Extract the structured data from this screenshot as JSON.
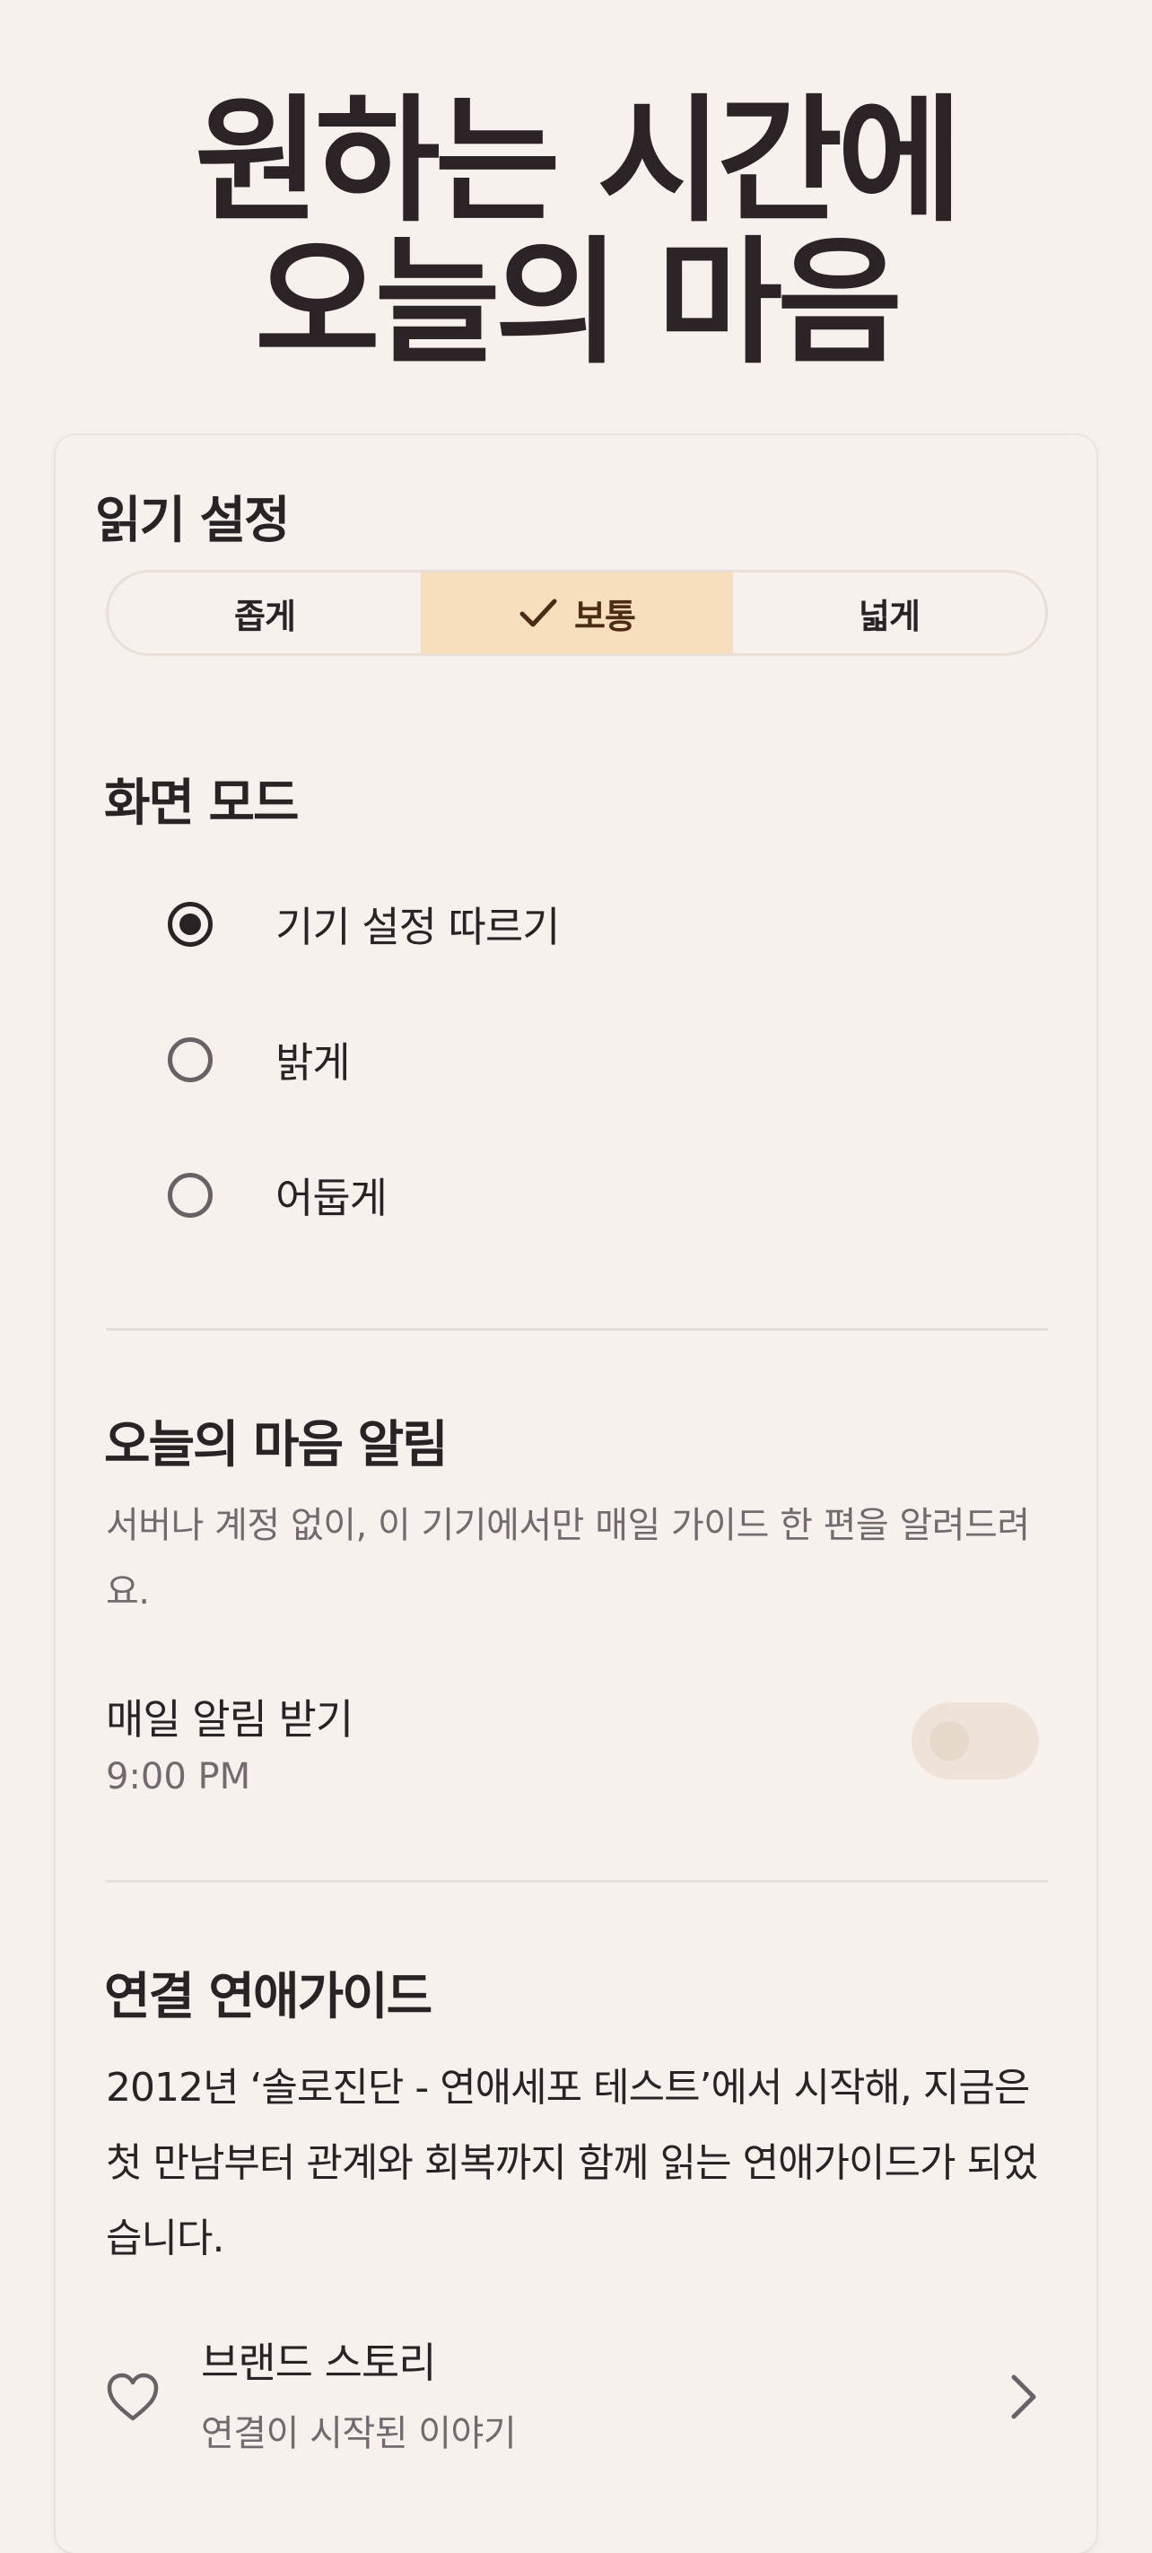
{
  "hero": {
    "line1": "원하는 시간에",
    "line2": "오늘의 마음"
  },
  "reading": {
    "title": "읽기 설정",
    "options": [
      "좁게",
      "보통",
      "넓게"
    ],
    "selected": "보통"
  },
  "screen_mode": {
    "title": "화면 모드",
    "options": [
      {
        "label": "기기 설정 따르기",
        "checked": true
      },
      {
        "label": "밝게",
        "checked": false
      },
      {
        "label": "어둡게",
        "checked": false
      }
    ]
  },
  "notification": {
    "title": "오늘의 마음 알림",
    "description": "서버나 계정 없이, 이 기기에서만 매일 가이드 한 편을 알려드려요.",
    "toggle_label": "매일 알림 받기",
    "time": "9:00 PM",
    "enabled": false
  },
  "about": {
    "title": "연결 연애가이드",
    "body": "2012년 ‘솔로진단 - 연애세포 테스트’에서 시작해, 지금은 첫 만남부터 관계와 회복까지 함께 읽는 연애가이드가 되었습니다.",
    "link_title": "브랜드 스토리",
    "link_subtitle": "연결이 시작된 이야기"
  },
  "colors": {
    "background": "#f6f1ec",
    "accent": "#f7dfbd",
    "text": "#2a2326",
    "muted": "#726a6e"
  }
}
